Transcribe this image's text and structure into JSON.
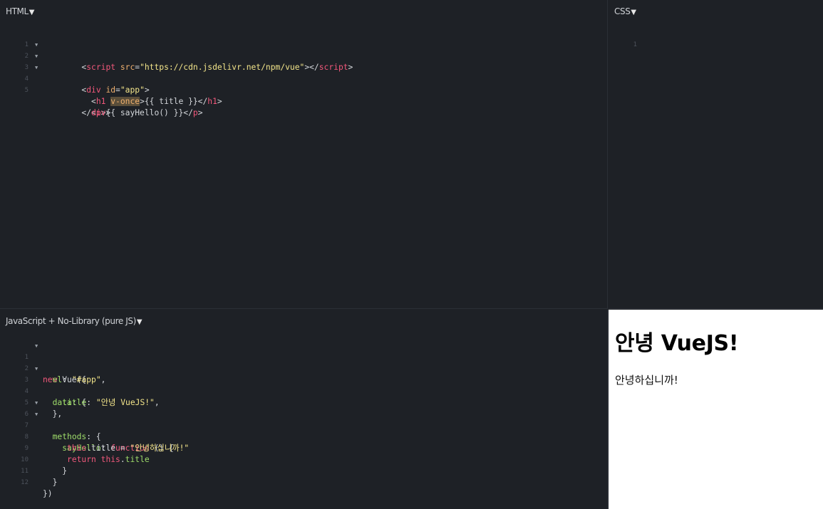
{
  "panels": {
    "html_label": "HTML",
    "css_label": "CSS",
    "js_label": "JavaScript + No-Library (pure JS)",
    "caret": "▼"
  },
  "html_editor": {
    "line_numbers": [
      "1",
      "2",
      "3",
      "4",
      "5"
    ],
    "lines": [
      [
        "<",
        "script",
        " src",
        "=",
        "\"https://cdn.jsdelivr.net/npm/vue\"",
        "></",
        "script",
        ">"
      ],
      [
        "<",
        "div",
        " id",
        "=",
        "\"app\"",
        ">"
      ],
      [
        "  <",
        "h1",
        " ",
        "v-once",
        ">{{ title }}</",
        "h1",
        ">"
      ],
      [
        "  <",
        "p",
        ">{{ sayHello() }}</",
        "p",
        ">"
      ],
      [
        "</",
        "div",
        ">"
      ]
    ]
  },
  "css_editor": {
    "line_numbers": [
      "1"
    ]
  },
  "js_editor": {
    "line_numbers": [
      "1",
      "2",
      "3",
      "4",
      "5",
      "6",
      "7",
      "8",
      "9",
      "10",
      "11",
      "12"
    ],
    "lines": [
      [
        "new",
        " Vue({"
      ],
      [
        "  ",
        "el",
        ": ",
        "\"#app\"",
        ","
      ],
      [
        "  ",
        "data",
        ": {"
      ],
      [
        "    ",
        "title",
        ": ",
        "\"안녕 VueJS!\"",
        ","
      ],
      [
        "  },"
      ],
      [
        "  ",
        "methods",
        ": {"
      ],
      [
        "    ",
        "sayHello",
        ": ",
        "function",
        " () {"
      ],
      [
        "     ",
        "this",
        ".title = ",
        "\"안녕하십니까!\""
      ],
      [
        "     ",
        "return",
        " ",
        "this",
        ".",
        "title"
      ],
      [
        "    }"
      ],
      [
        "  }"
      ],
      [
        "})"
      ]
    ]
  },
  "output": {
    "heading": "안녕 VueJS!",
    "paragraph": "안녕하십니까!"
  },
  "colors": {
    "editor_bg": "#1e2126",
    "tag": "#f2587b",
    "attribute": "#f0b06e",
    "string": "#f3e58a",
    "property": "#9fdd6a",
    "text": "#d4d7db",
    "line_number": "#4d525b",
    "output_bg": "#ffffff"
  }
}
